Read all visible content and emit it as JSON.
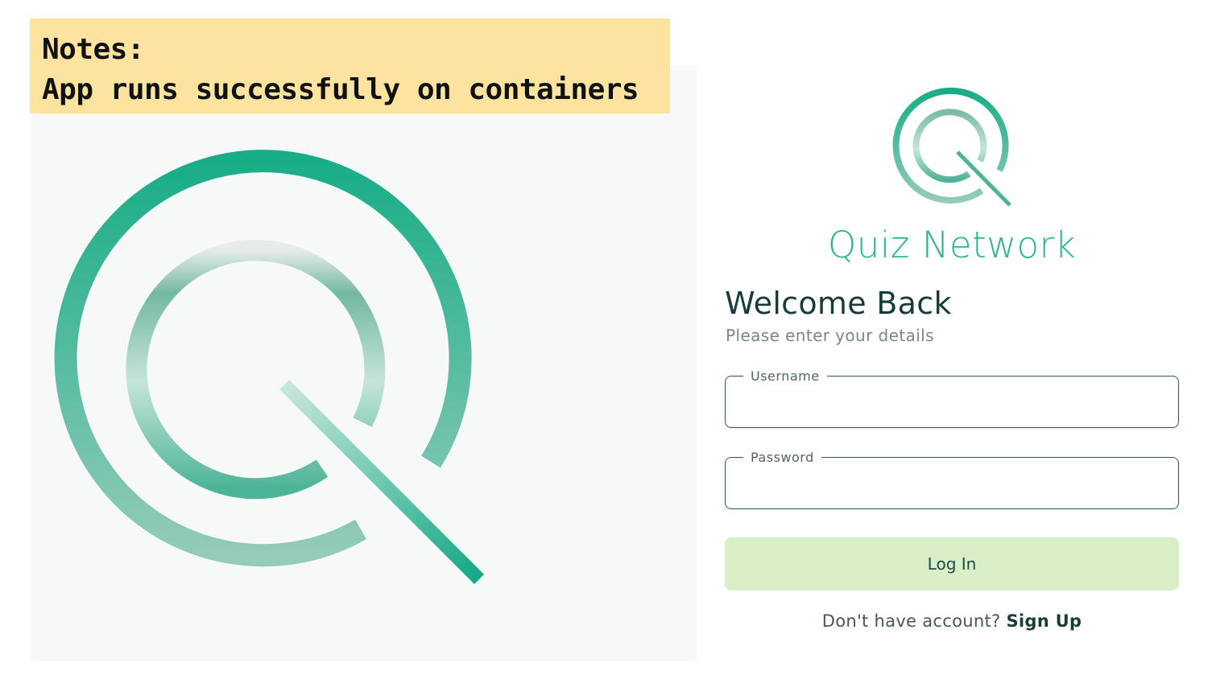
{
  "notes": {
    "title": "Notes:",
    "text": "App runs successfully on containers"
  },
  "brand": {
    "name": "Quiz Network",
    "logo_icon": "quiz-network-logo",
    "primary_color": "#1aae88",
    "light_color": "#c4e4d9"
  },
  "login": {
    "title": "Welcome Back",
    "subtitle": "Please enter your details",
    "username_label": "Username",
    "username_value": "",
    "password_label": "Password",
    "password_value": "",
    "login_button": "Log In",
    "signup_prompt": "Don't have account?",
    "signup_link": "Sign Up",
    "button_color": "#d8efc8"
  }
}
